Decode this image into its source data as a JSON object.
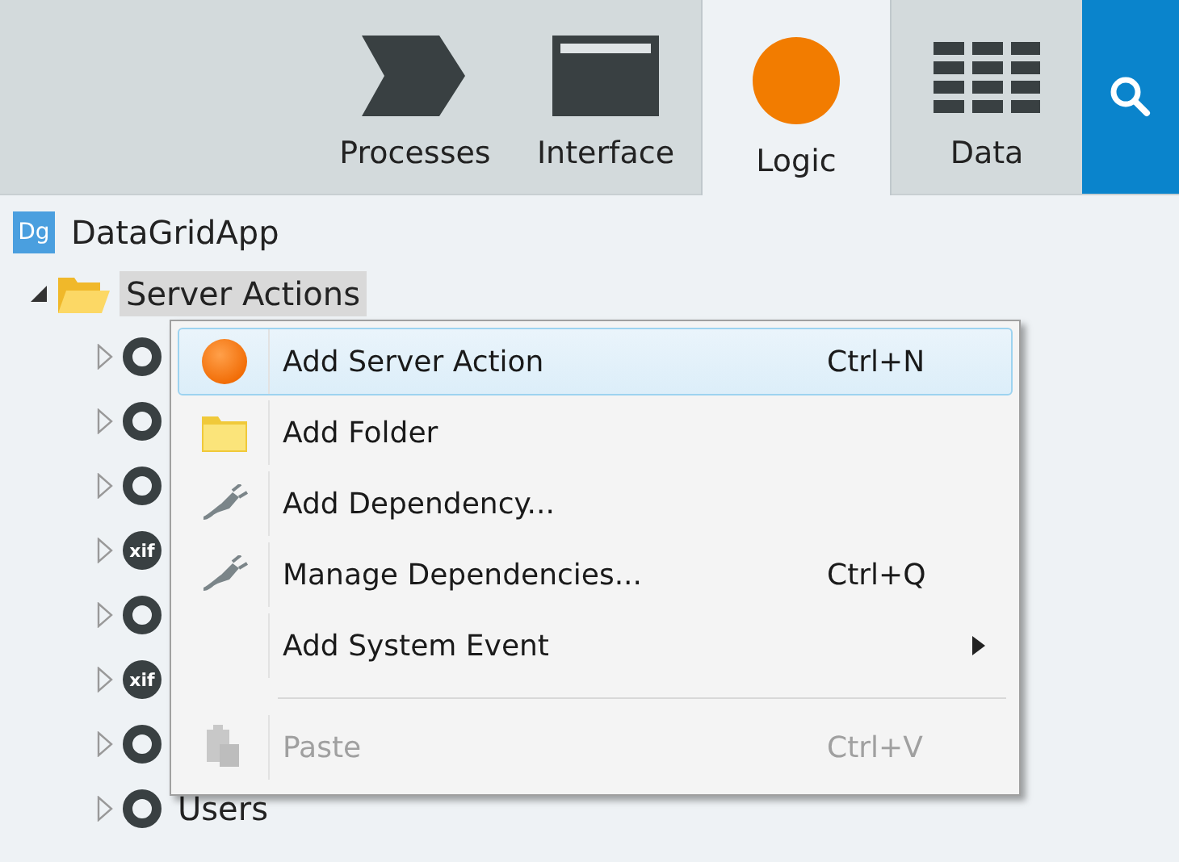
{
  "tabs": [
    {
      "label": "Processes",
      "kind": "chevron",
      "selected": false
    },
    {
      "label": "Interface",
      "kind": "window",
      "selected": false
    },
    {
      "label": "Logic",
      "kind": "circle",
      "selected": true
    },
    {
      "label": "Data",
      "kind": "grid",
      "selected": false
    }
  ],
  "tree": {
    "label": "DataGridApp",
    "badge": "Dg",
    "children": [
      {
        "label": "Server Actions",
        "selected": true,
        "expanded": true,
        "children": [
          {
            "kind": "ring",
            "expanded": false
          },
          {
            "kind": "ring",
            "expanded": false
          },
          {
            "kind": "ring",
            "expanded": false
          },
          {
            "kind": "xif",
            "badge": "xif",
            "expanded": false
          },
          {
            "kind": "ring",
            "expanded": false
          },
          {
            "kind": "xif",
            "badge": "xif",
            "expanded": false
          },
          {
            "kind": "ring",
            "expanded": false
          },
          {
            "kind": "ring",
            "label": "Users",
            "expanded": false
          }
        ]
      }
    ]
  },
  "context_menu": {
    "items": [
      {
        "kind": "circle",
        "label": "Add Server Action",
        "shortcut": "Ctrl+N",
        "selected": true,
        "disabled": false
      },
      {
        "kind": "folder",
        "label": "Add Folder",
        "selected": false,
        "disabled": false
      },
      {
        "kind": "plug",
        "label": "Add Dependency...",
        "selected": false,
        "disabled": false
      },
      {
        "kind": "plug",
        "label": "Manage Dependencies...",
        "shortcut": "Ctrl+Q",
        "selected": false,
        "disabled": false
      },
      {
        "kind": "plain",
        "label": "Add System Event",
        "submenu": true,
        "selected": false,
        "disabled": false
      },
      {
        "kind": "separator"
      },
      {
        "kind": "clipboard",
        "label": "Paste",
        "shortcut": "Ctrl+V",
        "selected": false,
        "disabled": true
      }
    ]
  }
}
